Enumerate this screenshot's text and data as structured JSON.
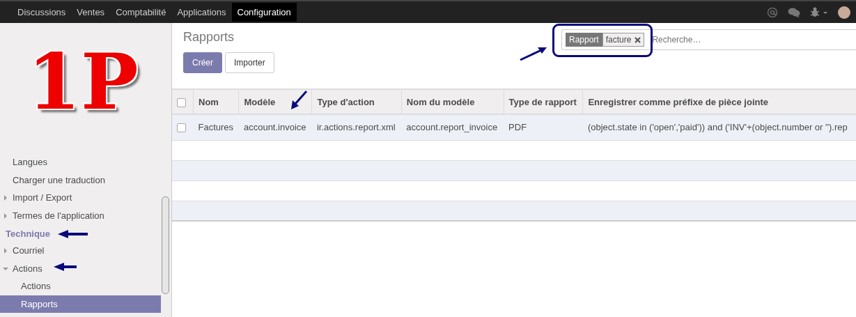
{
  "top_menu": [
    {
      "label": "Discussions",
      "selected": false
    },
    {
      "label": "Ventes",
      "selected": false
    },
    {
      "label": "Comptabilité",
      "selected": false
    },
    {
      "label": "Applications",
      "selected": false
    },
    {
      "label": "Configuration",
      "selected": true
    }
  ],
  "logo": {
    "text": "1P"
  },
  "sidebar": {
    "sections": [
      {
        "items": [
          {
            "label": "Langues",
            "selected": false
          },
          {
            "label": "Charger une traduction",
            "selected": false
          },
          {
            "label": "Import / Export",
            "selected": false,
            "expanded": false
          },
          {
            "label": "Termes de l'application",
            "selected": false,
            "expanded": false
          }
        ]
      },
      {
        "title": "Technique",
        "items": [
          {
            "label": "Courriel",
            "selected": false,
            "expanded": false
          },
          {
            "label": "Actions",
            "selected": false,
            "expanded": true,
            "children": [
              {
                "label": "Actions",
                "selected": false
              },
              {
                "label": "Rapports",
                "selected": true
              }
            ]
          }
        ]
      }
    ]
  },
  "page_title": "Rapports",
  "buttons": [
    {
      "label": "Créer",
      "kind": "primary"
    },
    {
      "label": "Importer",
      "kind": "default"
    }
  ],
  "search": {
    "facet": {
      "category": "Rapport",
      "value": "facture"
    },
    "placeholder": "Recherche…"
  },
  "table": {
    "header_checked": false,
    "columns": [
      "Nom",
      "Modèle",
      "Type d'action",
      "Nom du modèle",
      "Type de rapport",
      "Enregistrer comme préfixe de pièce jointe"
    ],
    "rows": [
      {
        "checked": false,
        "cells": [
          "Factures",
          "account.invoice",
          "ir.actions.report.xml",
          "account.report_invoice",
          "PDF",
          "(object.state in ('open','paid')) and ('INV'+(object.number or '').rep"
        ]
      }
    ]
  }
}
